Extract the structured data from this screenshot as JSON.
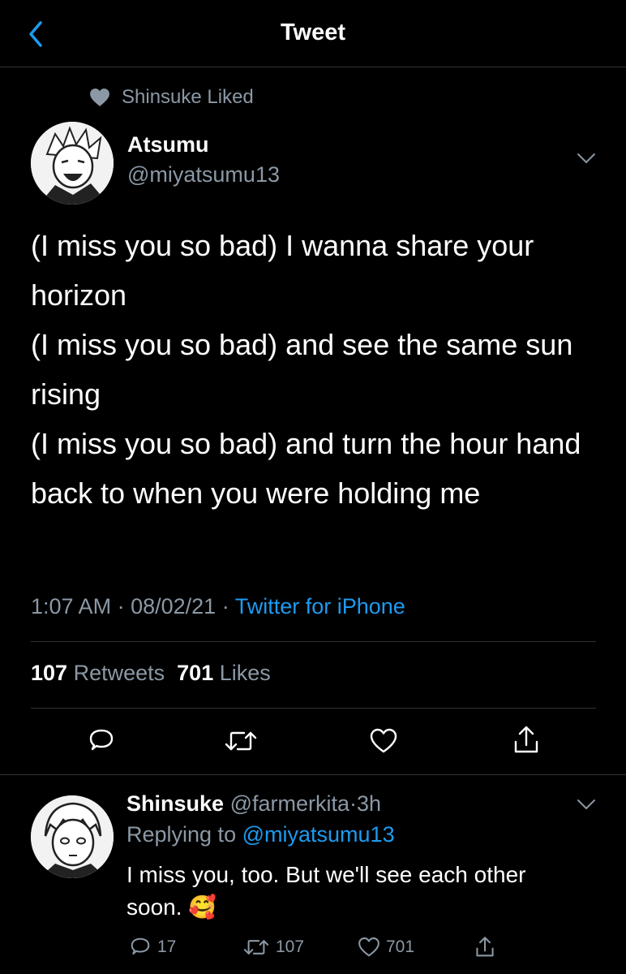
{
  "nav": {
    "title": "Tweet",
    "back_icon": "chevron-left-icon"
  },
  "liked": {
    "text": "Shinsuke Liked",
    "icon": "heart-icon"
  },
  "tweet": {
    "author_name": "Atsumu",
    "author_handle": "@miyatsumu13",
    "text": "(I miss you so bad) I wanna share your horizon\n(I miss you so bad) and see the same sun rising\n(I miss you so bad) and turn the hour hand back to when you were holding me",
    "time": "1:07 AM",
    "date": "08/02/21",
    "source": "Twitter for iPhone",
    "retweets_count": "107",
    "retweets_label": "Retweets",
    "likes_count": "701",
    "likes_label": "Likes"
  },
  "reply": {
    "author_name": "Shinsuke",
    "author_handle": "@farmerkita",
    "time_ago": "3h",
    "replying_prefix": "Replying to",
    "replying_to": "@miyatsumu13",
    "text": "I miss you, too. But we'll see each other soon.",
    "emoji": "🥰",
    "reply_count": "17",
    "retweet_count": "107",
    "like_count": "701"
  },
  "colors": {
    "background": "#000000",
    "accent": "#1d9bf0",
    "muted": "#8b98a5",
    "divider": "#2f3336"
  }
}
